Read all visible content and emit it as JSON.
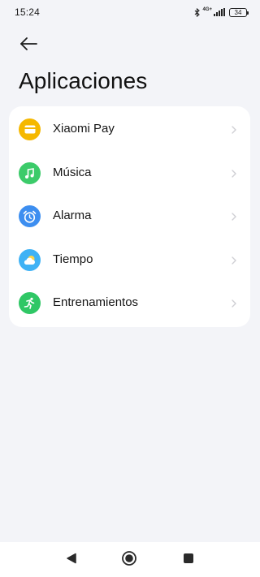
{
  "status_bar": {
    "time": "15:24",
    "network_label": "4G+",
    "battery_level": "34",
    "icons": [
      "bluetooth-icon",
      "signal-icon",
      "battery-icon"
    ]
  },
  "header": {
    "back_icon": "arrow-left-icon",
    "title": "Aplicaciones"
  },
  "apps": [
    {
      "label": "Xiaomi Pay",
      "icon": "card-icon",
      "color": "#f5b800"
    },
    {
      "label": "Música",
      "icon": "music-note-icon",
      "color": "#3ccb6a"
    },
    {
      "label": "Alarma",
      "icon": "alarm-clock-icon",
      "color": "#3d8ef0"
    },
    {
      "label": "Tiempo",
      "icon": "weather-icon",
      "color": "#3fb2f5"
    },
    {
      "label": "Entrenamientos",
      "icon": "running-icon",
      "color": "#2fc765"
    }
  ],
  "nav_bar": {
    "buttons": [
      "back-triangle-icon",
      "home-circle-icon",
      "recents-square-icon"
    ]
  }
}
